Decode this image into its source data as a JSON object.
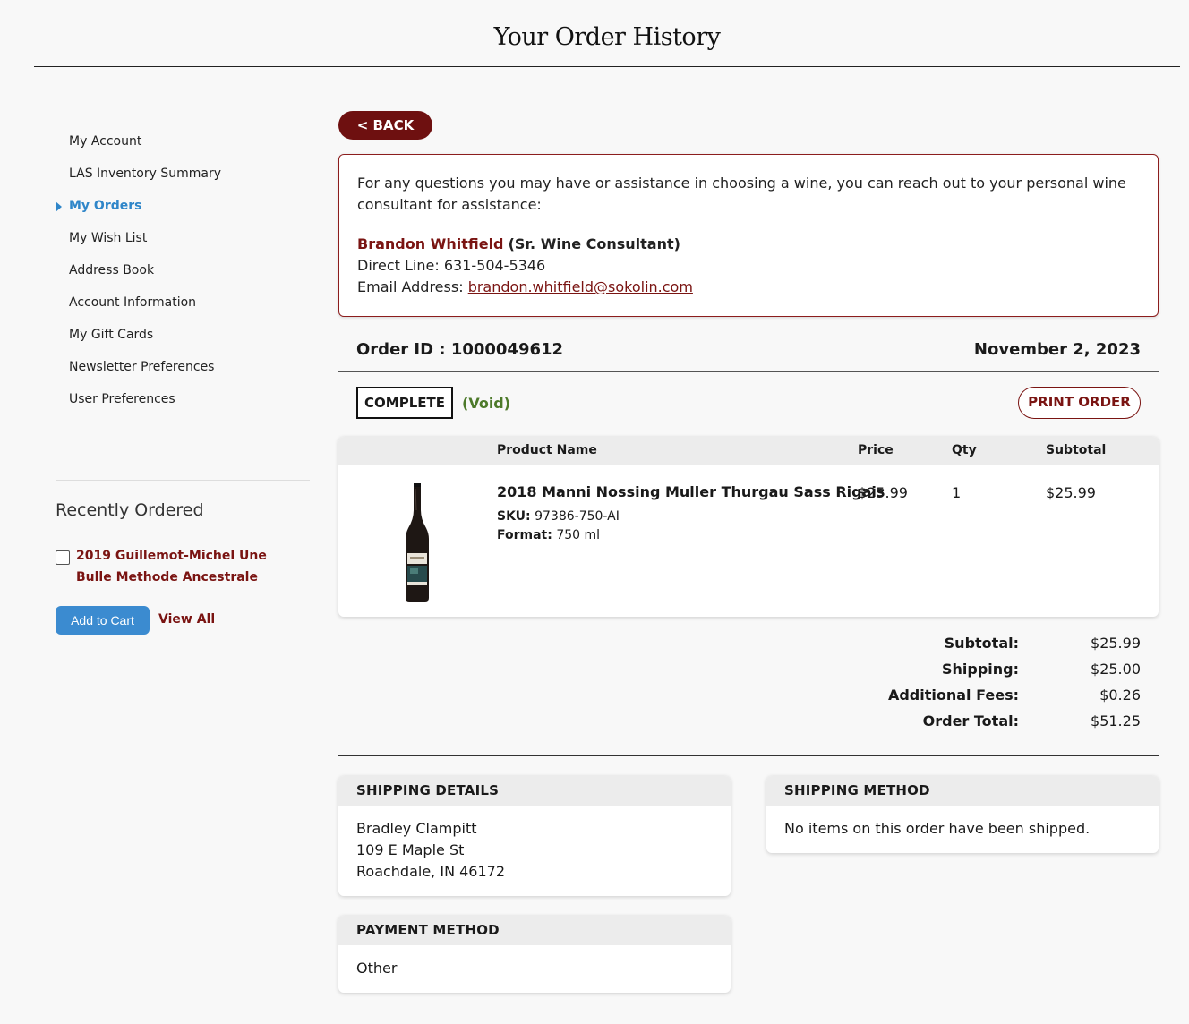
{
  "page": {
    "title": "Your Order History"
  },
  "sidebar": {
    "items": [
      {
        "label": "My Account"
      },
      {
        "label": "LAS Inventory Summary"
      },
      {
        "label": "My Orders"
      },
      {
        "label": "My Wish List"
      },
      {
        "label": "Address Book"
      },
      {
        "label": "Account Information"
      },
      {
        "label": "My Gift Cards"
      },
      {
        "label": "Newsletter Preferences"
      },
      {
        "label": "User Preferences"
      }
    ],
    "active_index": 2
  },
  "recently_ordered": {
    "title": "Recently Ordered",
    "item_name": "2019 Guillemot-Michel Une Bulle Methode Ancestrale",
    "add_to_cart_label": "Add to Cart",
    "view_all_label": "View All"
  },
  "back_label": "< BACK",
  "consultant": {
    "intro": "For any questions you may have or assistance in choosing a wine, you can reach out to your personal wine consultant for assistance:",
    "name": "Brandon Whitfield",
    "role": "(Sr. Wine Consultant)",
    "phone_label": "Direct Line:",
    "phone": "631-504-5346",
    "email_label": "Email Address:",
    "email": "brandon.whitfield@sokolin.com"
  },
  "order": {
    "id_label": "Order ID :",
    "id": "1000049612",
    "date": "November 2, 2023",
    "status": "COMPLETE",
    "status_note": "(Void)",
    "print_label": "PRINT ORDER"
  },
  "table": {
    "headers": {
      "product": "Product Name",
      "price": "Price",
      "qty": "Qty",
      "subtotal": "Subtotal"
    },
    "rows": [
      {
        "name": "2018 Manni Nossing Muller Thurgau Sass Rigais",
        "sku_label": "SKU:",
        "sku": "97386-750-AI",
        "format_label": "Format:",
        "format": "750 ml",
        "price": "$25.99",
        "qty": "1",
        "subtotal": "$25.99"
      }
    ]
  },
  "totals": {
    "subtotal_label": "Subtotal:",
    "subtotal": "$25.99",
    "shipping_label": "Shipping:",
    "shipping": "$25.00",
    "fees_label": "Additional Fees:",
    "fees": "$0.26",
    "total_label": "Order Total:",
    "total": "$51.25"
  },
  "shipping_details": {
    "title": "SHIPPING DETAILS",
    "name": "Bradley Clampitt",
    "street": "109 E Maple St",
    "city": "Roachdale, IN 46172"
  },
  "shipping_method": {
    "title": "SHIPPING METHOD",
    "text": "No items on this order have been shipped."
  },
  "payment_method": {
    "title": "PAYMENT METHOD",
    "text": "Other"
  },
  "colors": {
    "brand_red": "#7a1412",
    "active_blue": "#2f86c9",
    "void_green": "#4d7a2a"
  }
}
